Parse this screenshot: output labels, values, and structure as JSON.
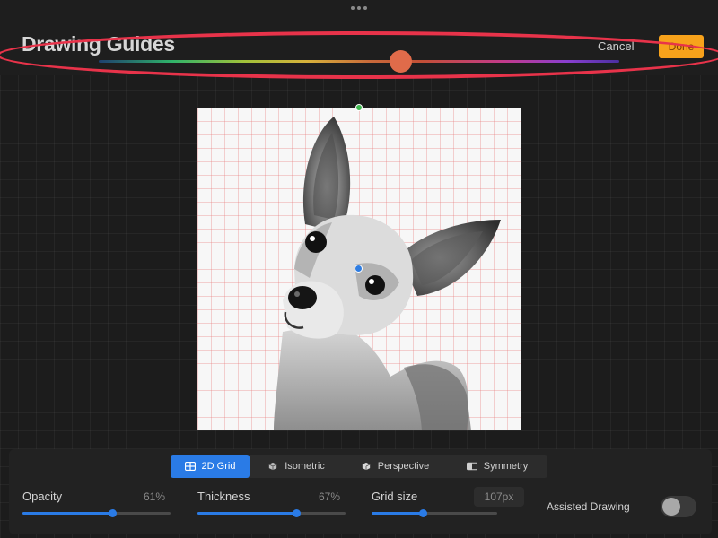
{
  "header": {
    "title": "Drawing Guides",
    "cancel_label": "Cancel",
    "done_label": "Done"
  },
  "colors": {
    "accent": "#f7a21b",
    "guide_color": "#e06b4a",
    "active_tab": "#2a7be6"
  },
  "guide_color_hue": 0.58,
  "tabs": [
    {
      "label": "2D Grid",
      "icon": "grid-icon",
      "active": true
    },
    {
      "label": "Isometric",
      "icon": "cube-icon",
      "active": false
    },
    {
      "label": "Perspective",
      "icon": "perspective-cube-icon",
      "active": false
    },
    {
      "label": "Symmetry",
      "icon": "symmetry-icon",
      "active": false
    }
  ],
  "sliders": {
    "opacity": {
      "label": "Opacity",
      "value_text": "61%",
      "value": 0.61
    },
    "thickness": {
      "label": "Thickness",
      "value_text": "67%",
      "value": 0.67
    },
    "grid_size": {
      "label": "Grid size",
      "value_text": "107px",
      "value": 0.41
    }
  },
  "assisted_drawing": {
    "label": "Assisted Drawing",
    "enabled": false
  }
}
